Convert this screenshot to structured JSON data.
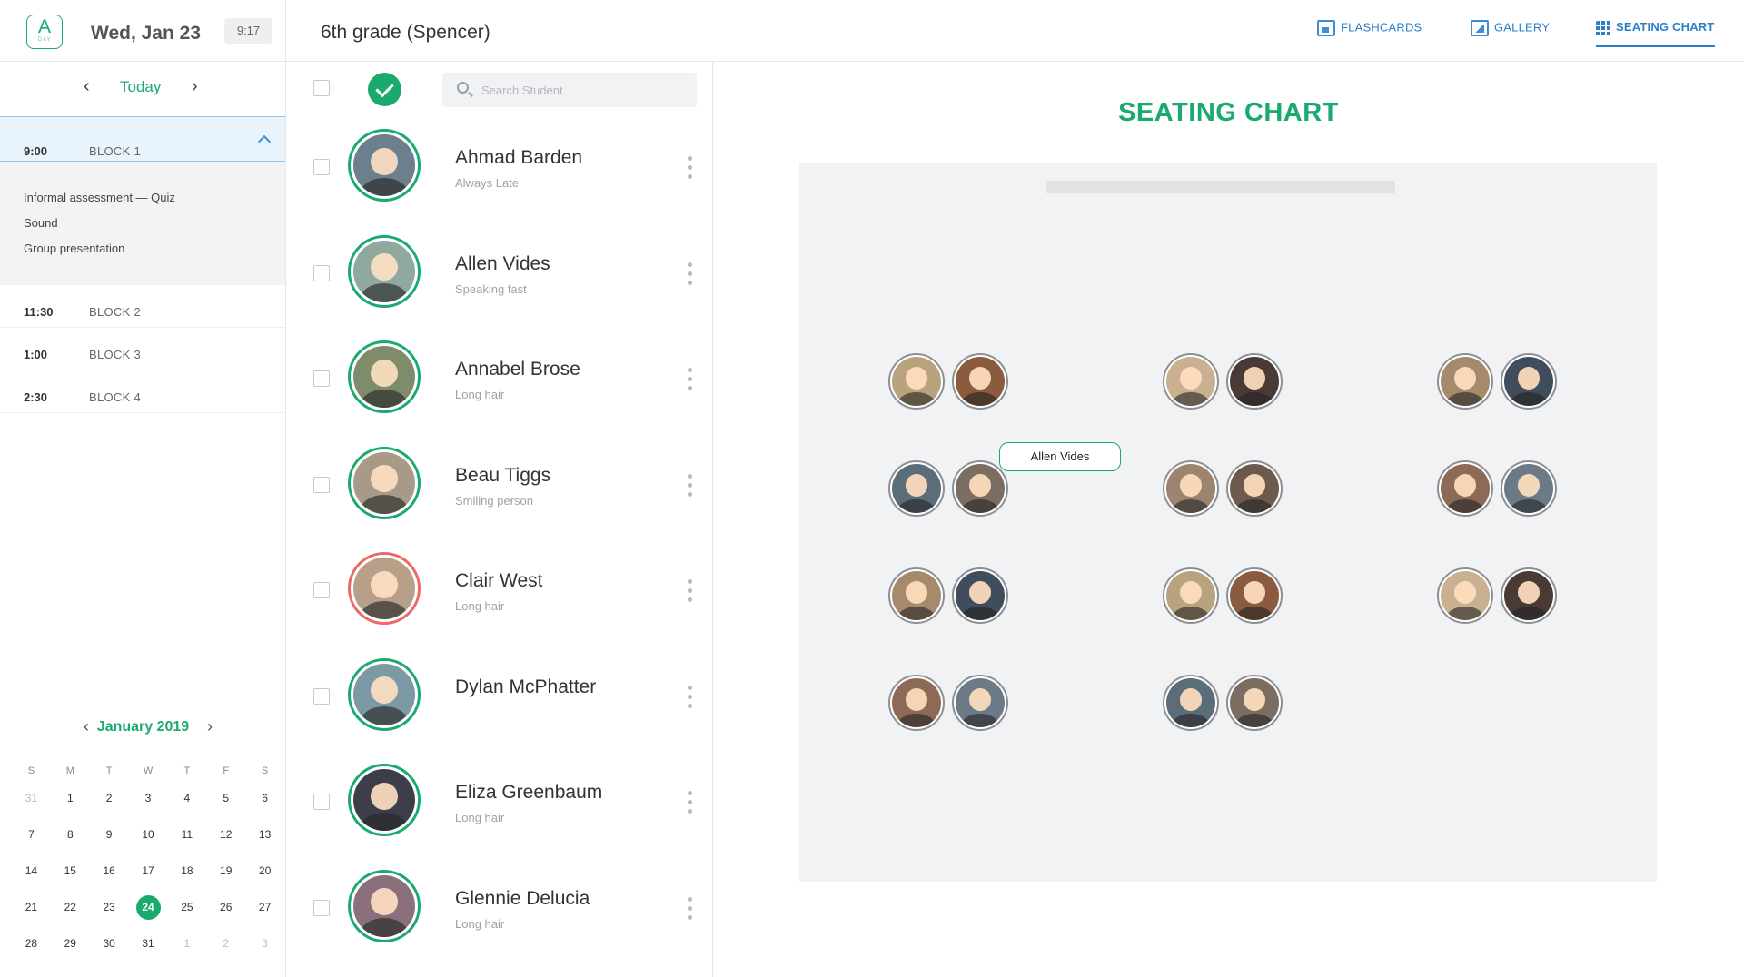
{
  "header": {
    "logo_letter": "A",
    "logo_sub": "DAY",
    "date": "Wed, Jan 23",
    "time": "9:17",
    "class_title": "6th grade (Spencer)",
    "tabs": [
      {
        "label": "FLASHCARDS",
        "icon": "flashcards-icon"
      },
      {
        "label": "GALLERY",
        "icon": "gallery-icon"
      },
      {
        "label": "SEATING CHART",
        "icon": "grid-icon",
        "active": true
      }
    ]
  },
  "day_nav": {
    "today_label": "Today"
  },
  "schedule": [
    {
      "time": "9:00",
      "name": "BLOCK 1",
      "expanded": true,
      "items": [
        "Informal assessment — Quiz",
        "Sound",
        "Group presentation"
      ]
    },
    {
      "time": "11:30",
      "name": "BLOCK 2"
    },
    {
      "time": "1:00",
      "name": "BLOCK 3"
    },
    {
      "time": "2:30",
      "name": "BLOCK 4"
    }
  ],
  "calendar": {
    "month_label": "January 2019",
    "weekdays": [
      "S",
      "M",
      "T",
      "W",
      "T",
      "F",
      "S"
    ],
    "weeks": [
      [
        "31",
        "1",
        "2",
        "3",
        "4",
        "5",
        "6"
      ],
      [
        "7",
        "8",
        "9",
        "10",
        "11",
        "12",
        "13"
      ],
      [
        "14",
        "15",
        "16",
        "17",
        "18",
        "19",
        "20"
      ],
      [
        "21",
        "22",
        "23",
        "24",
        "25",
        "26",
        "27"
      ],
      [
        "28",
        "29",
        "30",
        "31",
        "1",
        "2",
        "3"
      ]
    ],
    "selected": "24"
  },
  "search": {
    "placeholder": "Search Student"
  },
  "students": [
    {
      "name": "Ahmad Barden",
      "note": "Always Late",
      "status": "present"
    },
    {
      "name": "Allen Vides",
      "note": "Speaking fast",
      "status": "present"
    },
    {
      "name": "Annabel Brose",
      "note": "Long hair",
      "status": "present"
    },
    {
      "name": "Beau Tiggs",
      "note": "Smiling person",
      "status": "present"
    },
    {
      "name": "Clair West",
      "note": "Long hair",
      "status": "late"
    },
    {
      "name": "Dylan McPhatter",
      "note": "",
      "status": "present"
    },
    {
      "name": "Eliza Greenbaum",
      "note": "Long hair",
      "status": "present"
    },
    {
      "name": "Glennie Delucia",
      "note": "Long hair",
      "status": "present"
    }
  ],
  "seating_chart": {
    "title": "SEATING CHART",
    "tooltip": "Allen Vides"
  },
  "colors": {
    "accent_green": "#1aaa6f",
    "tab_blue": "#2c7fc7",
    "late_red": "#ea6a64"
  }
}
